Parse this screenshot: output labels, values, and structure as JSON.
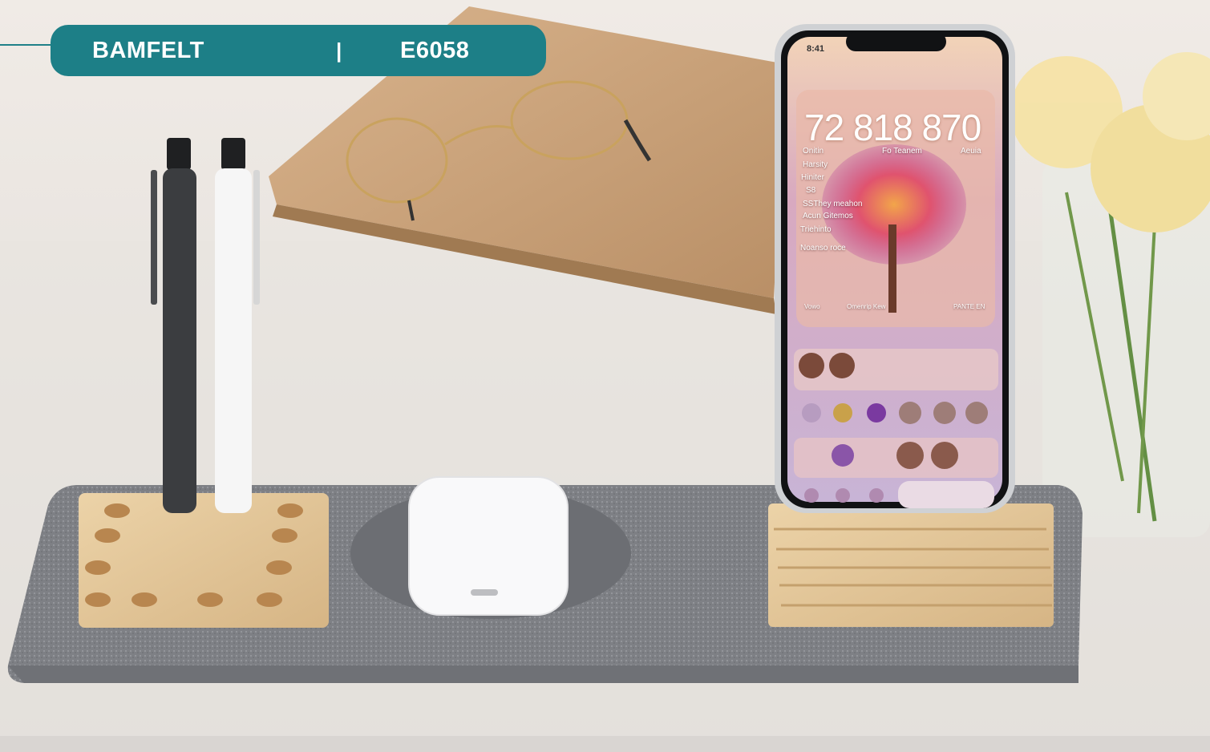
{
  "header": {
    "brand": "BAMFELT",
    "separator": "|",
    "code": "E6058"
  },
  "phone": {
    "status_time": "8:41",
    "clock": "72 818 870",
    "widget_lines": [
      "Onitin",
      "Fo Teanem",
      "Aeuia",
      "Harsity",
      "Hiniter",
      "S8",
      "SSThey meahon",
      "Acun Gitemos",
      "Triehinto",
      "Noanso roce",
      "Vowo",
      "Omenrip Kew",
      "PANTE EN"
    ]
  },
  "colors": {
    "header_bg": "#1d7f87",
    "felt": "#7d7f84",
    "bamboo": "#e0c497"
  }
}
